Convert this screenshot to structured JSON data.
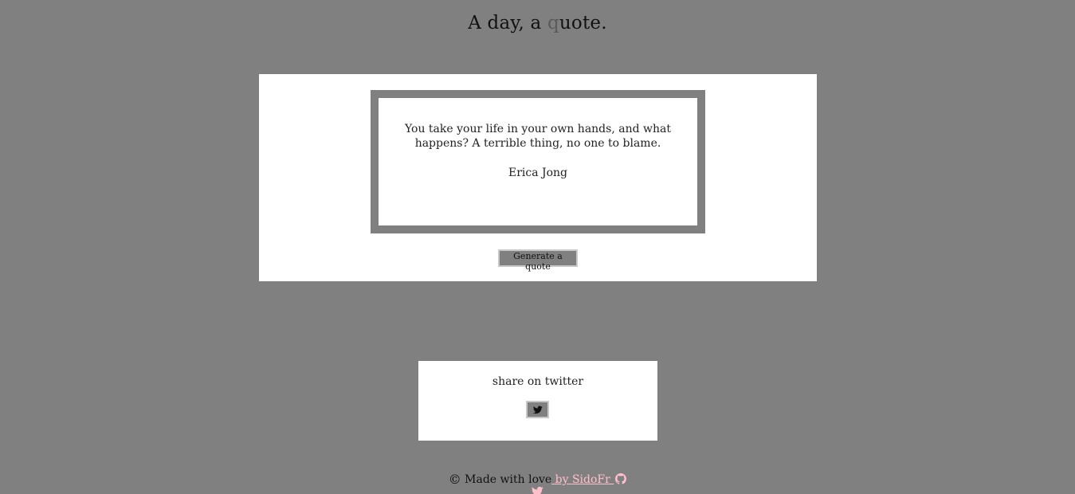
{
  "header": {
    "title_part1": "A day, a ",
    "title_accent": "q",
    "title_part2": "uote."
  },
  "quote": {
    "text": "You take your life in your own hands, and what happens? A terrible thing, no one to blame.",
    "author": "Erica Jong",
    "generate_label": "Generate a quote"
  },
  "share": {
    "label": "share on twitter",
    "icon": "twitter-icon"
  },
  "footer": {
    "copyright_symbol": "©",
    "made_with": " Made with love",
    "author_link": " by SidoFr ",
    "icons": [
      "github-icon",
      "twitter-icon"
    ]
  },
  "colors": {
    "background": "#808080",
    "panel": "#ffffff",
    "link": "#ffc0cb",
    "button": "#808080"
  }
}
